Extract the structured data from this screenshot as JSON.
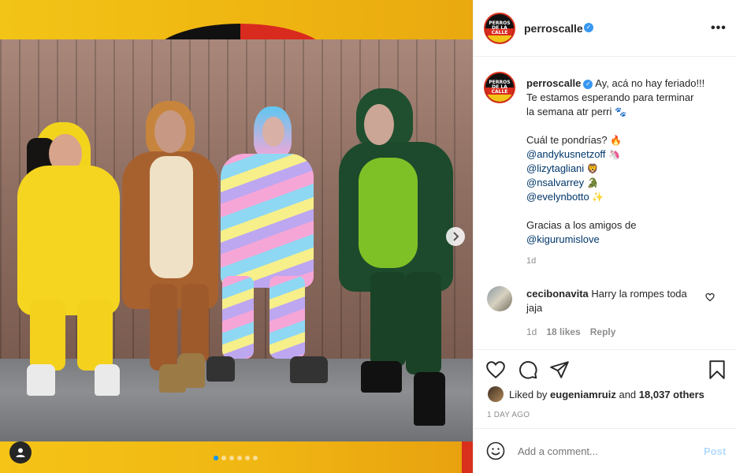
{
  "post": {
    "username": "perroscalle",
    "verified": true,
    "avatar_text": "PERROS DE LA CALLE"
  },
  "caption": {
    "line1": "Ay, acá no hay feriado!!!",
    "line2": "Te estamos esperando para terminar",
    "line3": "la semana atr perri",
    "line3_emoji": "🐾",
    "question": "Cuál te pondrías?",
    "question_emoji": "🔥",
    "mentions": [
      {
        "handle": "@andykusnetzoff",
        "emoji": "🦄"
      },
      {
        "handle": "@lizytagliani",
        "emoji": "🦁"
      },
      {
        "handle": "@nsalvarrey",
        "emoji": "🐊"
      },
      {
        "handle": "@evelynbotto",
        "emoji": "✨"
      }
    ],
    "thanks": "Gracias a los amigos de",
    "thanks_mention": "@kigurumislove",
    "time": "1d"
  },
  "comment": {
    "username": "cecibonavita",
    "text": "Harry la rompes toda jaja",
    "time": "1d",
    "likes": "18 likes",
    "reply": "Reply"
  },
  "likes": {
    "prefix": "Liked by",
    "user": "eugeniamruiz",
    "and": "and",
    "others": "18,037 others"
  },
  "posted": "1 DAY AGO",
  "add_comment": {
    "placeholder": "Add a comment...",
    "post_label": "Post"
  },
  "carousel": {
    "count": 6,
    "active_index": 0
  },
  "icons": {
    "more": "more-options-icon",
    "next": "chevron-right-icon",
    "tag": "user-tag-icon",
    "like": "heart-icon",
    "comment": "comment-icon",
    "share": "share-icon",
    "save": "bookmark-icon",
    "emoji": "smiley-icon"
  },
  "colors": {
    "verified": "#3897f0",
    "mention": "#00376b",
    "post_disabled": "#b3dbff",
    "dot_active": "#0095f6"
  }
}
